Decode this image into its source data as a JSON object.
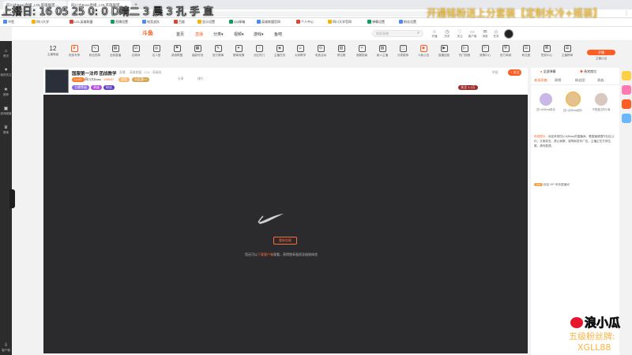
{
  "browser": {
    "tabs": [
      {
        "label": "四川大Boss直播_LOL英雄联盟..."
      },
      {
        "label": "四川大Boss直播_LOL英雄联盟..."
      }
    ],
    "new_tab_label": "+",
    "bookmarks": [
      "书签",
      "四川大学",
      "LOL英雄联盟",
      "直播设置",
      "电竞战队",
      "百度",
      "显示设置",
      "QQ邮箱",
      "英雄联盟官网",
      "个人中心",
      "四川大学官网",
      "弹幕设置",
      "粉丝设置"
    ]
  },
  "overlay": {
    "top_left": "上播日: 16 05 25 0: 0 D晴二 3 晨 3 孔 手 直",
    "top_right": "开通铭粉送上分套装【定制水冷+摇装】",
    "bottom_logo": "浪小瓜",
    "fan_badge_label": "五级粉丝牌:",
    "fan_badge_code": "XGLL88"
  },
  "sidebar": [
    {
      "icon": "home-icon",
      "label": "首页"
    },
    {
      "icon": "follow-icon",
      "label": "我的关注"
    },
    {
      "icon": "star-icon",
      "label": "推荐"
    },
    {
      "icon": "game-icon",
      "label": "游戏频道"
    },
    {
      "icon": "trophy-icon",
      "label": "赛事"
    },
    {
      "icon": "download-icon",
      "label": "客户端"
    }
  ],
  "header": {
    "logo": "斗鱼",
    "nav": [
      {
        "label": "首页",
        "active": false
      },
      {
        "label": "直播",
        "active": true
      },
      {
        "label": "分类▾",
        "active": false
      },
      {
        "label": "视频▾",
        "active": false
      },
      {
        "label": "游戏▾",
        "active": false
      },
      {
        "label": "鱼吧",
        "active": false
      }
    ],
    "search_placeholder": "搜索直播",
    "right_icons": [
      "开播",
      "历史",
      "关注",
      "客户端",
      "消息",
      "任务"
    ]
  },
  "categories": {
    "count": "12",
    "count_label": "主播等级",
    "items": [
      "贵族专享",
      "粉丝勋章",
      "全部直播",
      "召唤师",
      "名人堂",
      "英雄联盟",
      "高能时刻",
      "官方赛事",
      "赛事竞猜",
      "分区热门",
      "主播任务",
      "大师教学",
      "电竞活动",
      "排位赛",
      "观赛指南",
      "新人主播",
      "分类推荐",
      "斗鱼公告",
      "直播回放",
      "热门视频",
      "竞猜中心",
      "官方商城",
      "粉丝团",
      "签到中心",
      "主播榜单",
      "开播工具"
    ],
    "right_button": "开播",
    "right_button_2": "主播认证"
  },
  "room": {
    "title": "国服第一法师 团战教学",
    "owner_tag": "直播",
    "category": "英雄联盟 · LOL · 高端局",
    "streamer_name": "四川大Boss",
    "hot": "198047",
    "level": "Lv.32",
    "room_badge_1": "超管",
    "room_badge_2": "分区第一",
    "tag_1": "主播等级",
    "tag_2": "贵族",
    "tag_3": "粉丝",
    "report": "举报",
    "follow_count": "关注 1.2万",
    "follow_button": "+ 关注",
    "share": "分享",
    "ranking": "排行"
  },
  "video": {
    "button_label": "重新加载",
    "message_prefix": "您还可以",
    "message_link": "下载客户端",
    "message_suffix": "观看，获得独享画质及极致体验"
  },
  "chat": {
    "top_buttons": [
      "全部弹幕",
      "贵宾席位"
    ],
    "tabs": [
      "本场贡献",
      "周榜",
      "粉丝团",
      "贵族"
    ],
    "top_users": [
      {
        "name": "四川大Boss粉丝",
        "gift": "1"
      },
      {
        "name": "四川大Boss团长",
        "gift": "2"
      },
      {
        "name": "不想溜达的小鱼",
        "gift": "3"
      }
    ],
    "notice_label": "系统提示",
    "notice": "欢迎来到四川大Boss的直播间，看直播请遵守社区公约，文明发言，禁止刷屏、谩骂和发布广告。主播正在打排位赛，请勿剧透。",
    "welcome": "欢迎 VIP 来到直播间"
  }
}
